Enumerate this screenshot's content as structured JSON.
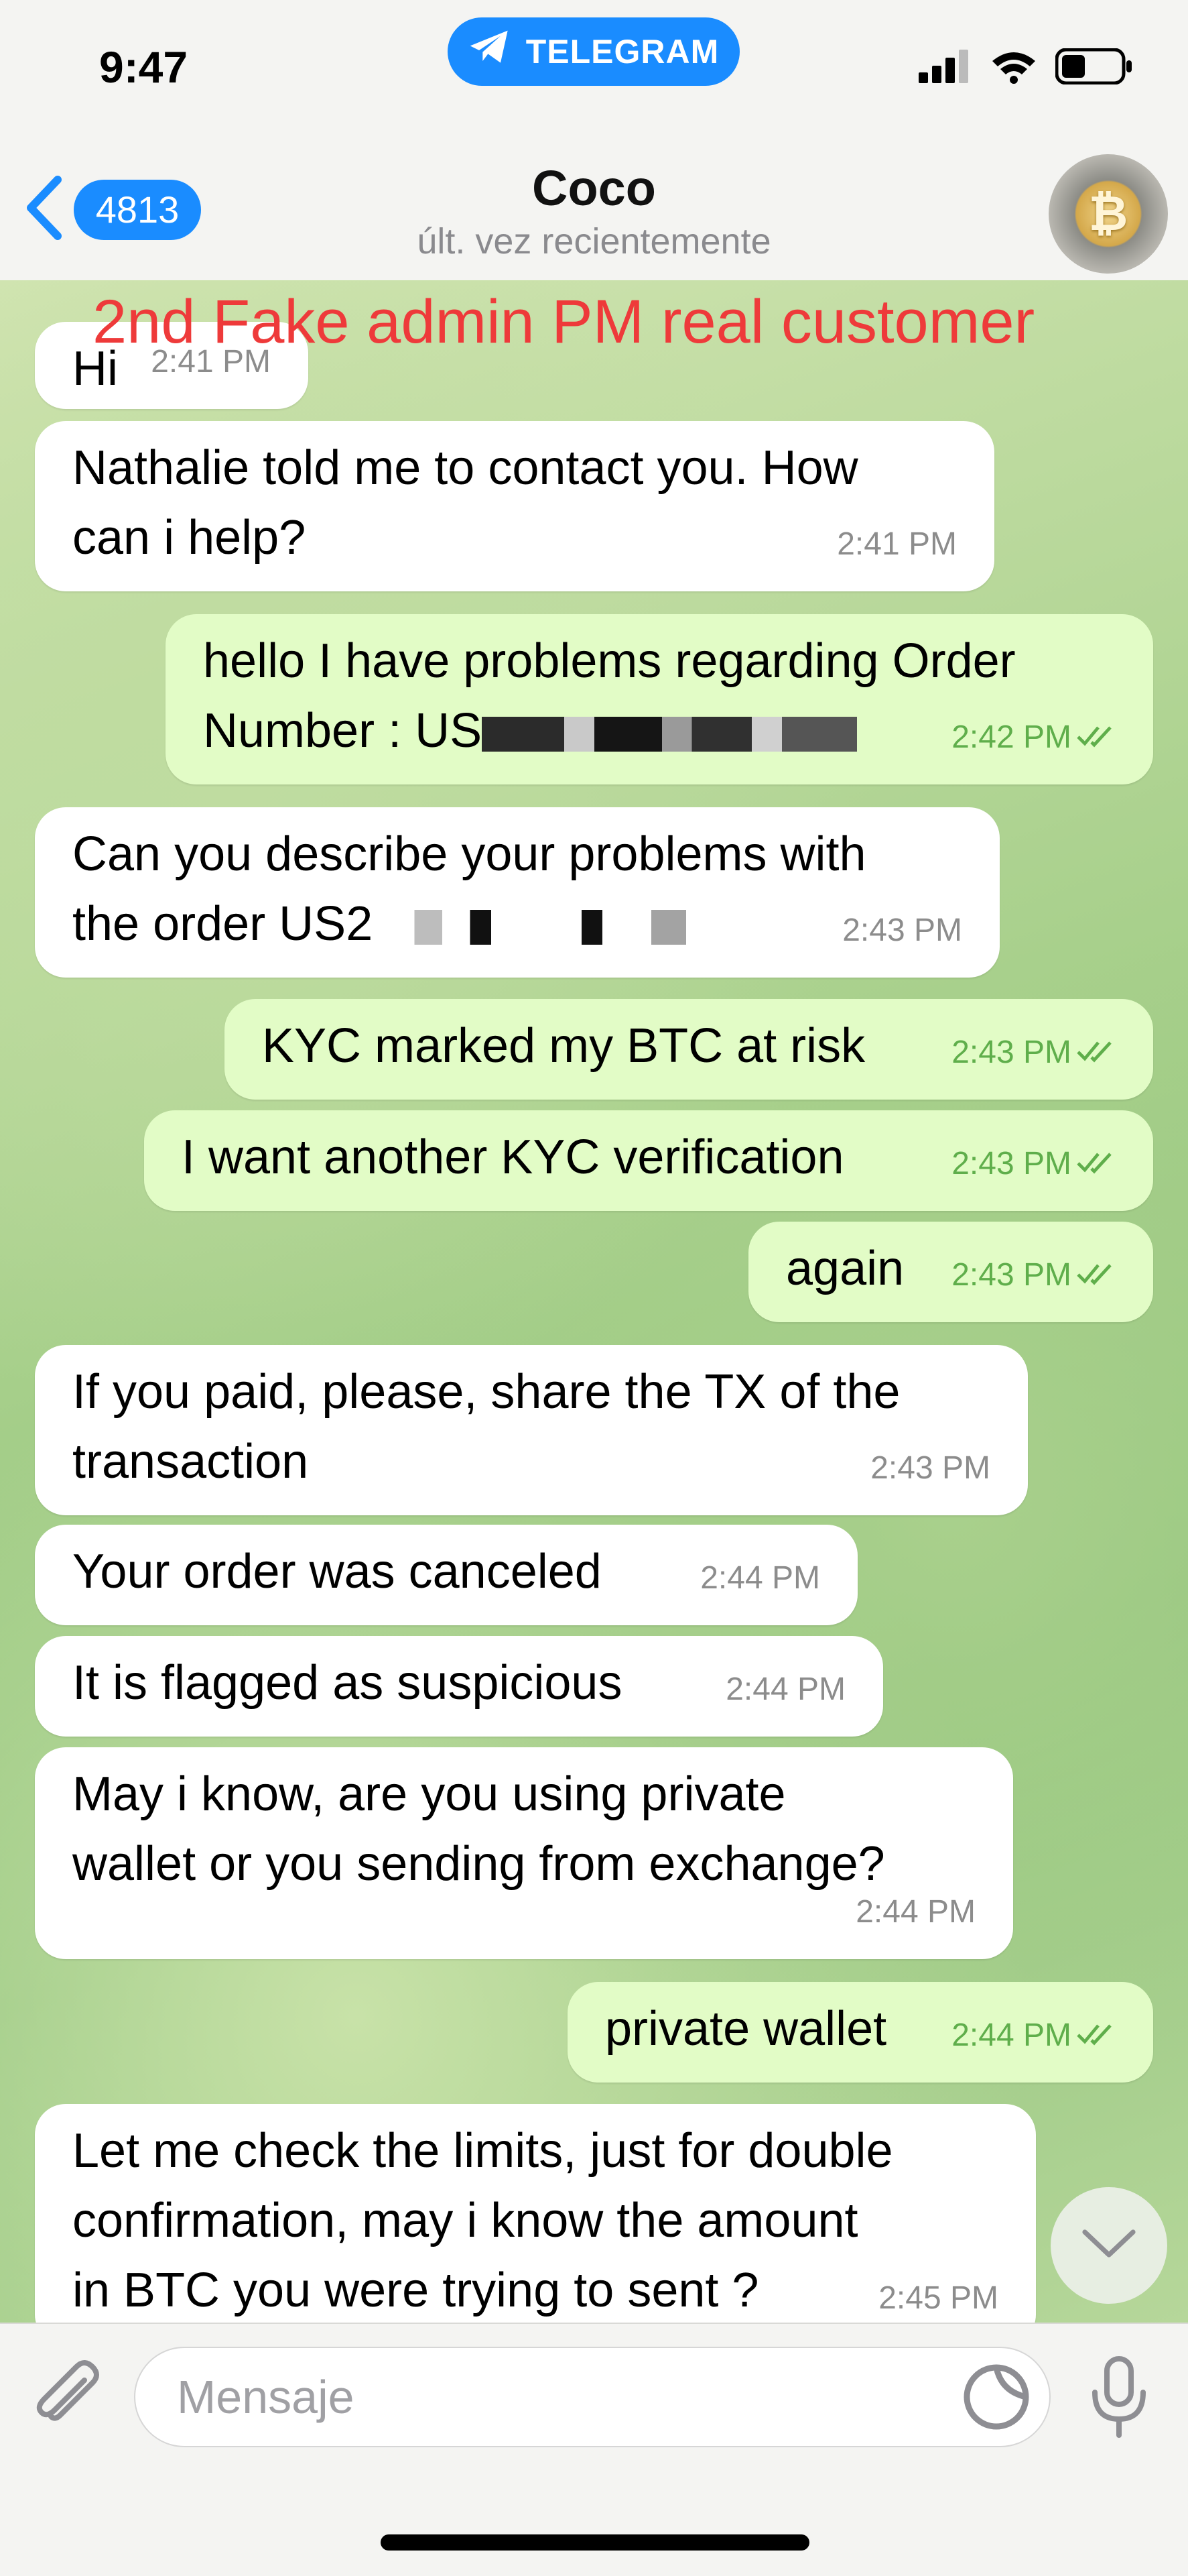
{
  "status_bar": {
    "time": "9:47",
    "app_pill": "TELEGRAM"
  },
  "header": {
    "unread_count": "4813",
    "title": "Coco",
    "subtitle": "últ. vez recientemente"
  },
  "overlay_text": "2nd Fake admin PM real customer",
  "messages": [
    {
      "dir": "in",
      "lines": [
        "Hi"
      ],
      "time": "2:41 PM"
    },
    {
      "dir": "in",
      "lines": [
        "Nathalie told me to contact you. How",
        "can i help?"
      ],
      "time": "2:41 PM"
    },
    {
      "dir": "out",
      "lines": [
        "hello I have problems regarding Order",
        "Number : US"
      ],
      "time": "2:42 PM"
    },
    {
      "dir": "in",
      "lines": [
        "Can you describe your problems with",
        "the order US2"
      ],
      "time": "2:43 PM"
    },
    {
      "dir": "out",
      "lines": [
        "KYC marked my BTC at risk"
      ],
      "time": "2:43 PM"
    },
    {
      "dir": "out",
      "lines": [
        "I want another KYC verification"
      ],
      "time": "2:43 PM"
    },
    {
      "dir": "out",
      "lines": [
        "again"
      ],
      "time": "2:43 PM"
    },
    {
      "dir": "in",
      "lines": [
        "If you paid, please, share the TX of the",
        "transaction"
      ],
      "time": "2:43 PM"
    },
    {
      "dir": "in",
      "lines": [
        "Your order was canceled"
      ],
      "time": "2:44 PM"
    },
    {
      "dir": "in",
      "lines": [
        "It is flagged as suspicious"
      ],
      "time": "2:44 PM"
    },
    {
      "dir": "in",
      "lines": [
        "May i know, are you using private",
        "wallet or you sending from exchange?"
      ],
      "time": "2:44 PM"
    },
    {
      "dir": "out",
      "lines": [
        "private wallet"
      ],
      "time": "2:44 PM"
    },
    {
      "dir": "in",
      "lines": [
        "Let me check the limits, just for double",
        "confirmation, may i know the amount",
        "in BTC you were trying to sent ?"
      ],
      "time": "2:45 PM"
    }
  ],
  "composer": {
    "placeholder": "Mensaje"
  },
  "colors": {
    "accent": "#1a8cff",
    "outgoing_bubble": "#e2fcc6",
    "incoming_bubble": "#ffffff",
    "watermark": "#ee3a3a"
  },
  "icons": [
    "telegram-plane-icon",
    "signal-icon",
    "wifi-icon",
    "battery-icon",
    "back-chevron-icon",
    "attach-icon",
    "sticker-icon",
    "mic-icon",
    "read-check-icon",
    "scroll-down-icon"
  ]
}
